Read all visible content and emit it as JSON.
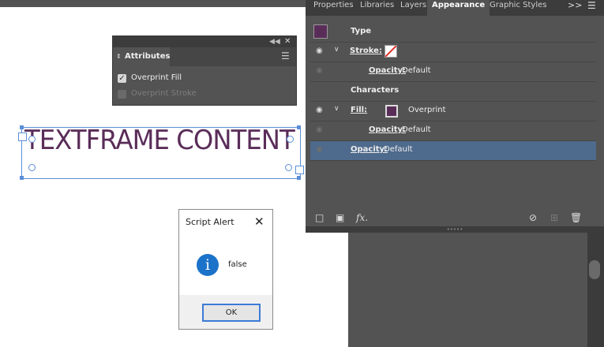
{
  "attributes_panel": {
    "title": "Attributes",
    "collapse_icon": "double-chevron-left-icon",
    "close_icon": "close-icon",
    "menu_icon": "hamburger-menu-icon",
    "overprint_fill_label": "Overprint Fill",
    "overprint_fill_checked": true,
    "overprint_stroke_label": "Overprint Stroke",
    "overprint_stroke_checked": false
  },
  "text_frame": {
    "content": "TEXTFRAME CONTENT",
    "color": "#5a2d59"
  },
  "appearance_panel": {
    "tabs": [
      "Properties",
      "Libraries",
      "Layers",
      "Appearance",
      "Graphic Styles"
    ],
    "active_tab": "Appearance",
    "more_icon": "double-chevron-right-icon",
    "menu_icon": "hamburger-menu-icon",
    "rows": {
      "type": "Type",
      "stroke_label": "Stroke:",
      "stroke_opacity_label": "Opacity:",
      "stroke_opacity_value": "Default",
      "characters": "Characters",
      "fill_label": "Fill:",
      "fill_value": "Overprint",
      "fill_opacity_label": "Opacity:",
      "fill_opacity_value": "Default",
      "opacity_label": "Opacity:",
      "opacity_value": "Default"
    },
    "fx_label": "fx.",
    "swatch_color": "#5a2d59",
    "selected_row_color": "#4e6a8c"
  },
  "dialog": {
    "title": "Script Alert",
    "message": "false",
    "ok_label": "OK",
    "icon": "info-icon"
  }
}
